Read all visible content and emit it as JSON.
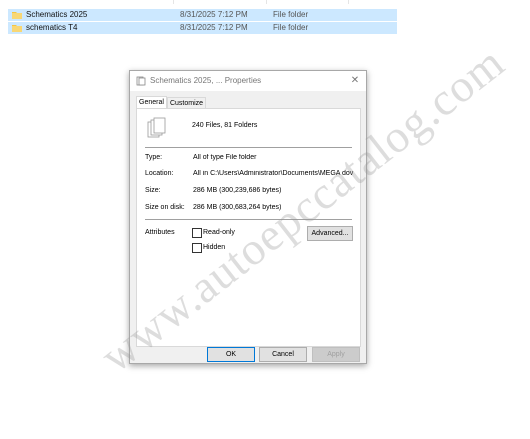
{
  "files": [
    {
      "name": "Schematics 2025",
      "date": "8/31/2025 7:12 PM",
      "type": "File folder"
    },
    {
      "name": "schematics T4",
      "date": "8/31/2025 7:12 PM",
      "type": "File folder"
    }
  ],
  "dialog": {
    "title": "Schematics 2025, ... Properties",
    "close_glyph": "✕",
    "tabs": {
      "general": "General",
      "customize": "Customize"
    },
    "summary": "240 Files, 81 Folders",
    "type_label": "Type:",
    "type_value": "All of type File folder",
    "location_label": "Location:",
    "location_value": "All in C:\\Users\\Administrator\\Documents\\MEGA dov",
    "size_label": "Size:",
    "size_value": "286 MB (300,239,686 bytes)",
    "size_on_disk_label": "Size on disk:",
    "size_on_disk_value": "286 MB (300,683,264 bytes)",
    "attributes_label": "Attributes",
    "readonly_label": "Read-only",
    "hidden_label": "Hidden",
    "advanced_button": "Advanced...",
    "ok_button": "OK",
    "cancel_button": "Cancel",
    "apply_button": "Apply"
  },
  "watermark": "www.autoepccatalog.com",
  "colors": {
    "selection": "#cce8ff",
    "folder": "#f4c542",
    "accent": "#0078d7"
  },
  "icons": {
    "folder": "folder-icon",
    "title": "folder-properties-icon",
    "files": "multiple-files-icon"
  }
}
